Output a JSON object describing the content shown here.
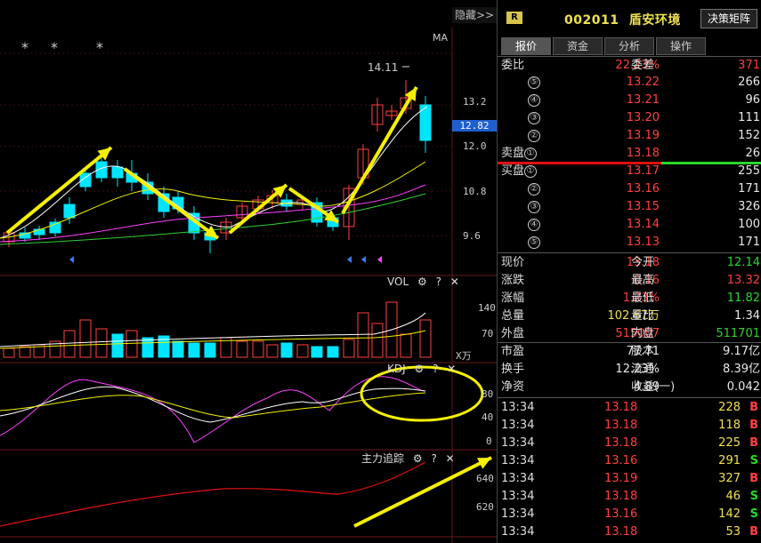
{
  "chart": {
    "hide_label": "隐藏>>",
    "ma_label": "MA",
    "high_mark": "14.11",
    "price_axis": [
      "13.2",
      "12.0",
      "10.8",
      "9.6"
    ],
    "current_price_tag": "12.82",
    "vol_title": "VOL",
    "vol_axis": [
      "140",
      "70"
    ],
    "vol_unit": "X万",
    "kdj_title": "KDJ",
    "kdj_axis": [
      "80",
      "40",
      "0"
    ],
    "main_track_title": "主力追踪",
    "main_track_axis": [
      "640",
      "620"
    ],
    "asterisk": "*",
    "gear_icon": "gear-icon",
    "help_label": "?",
    "close_label": "✕"
  },
  "panel": {
    "badge": "R",
    "stock_code": "002011",
    "stock_name": "盾安环境",
    "decision_button": "决策矩阵",
    "tabs": [
      "报价",
      "资金",
      "分析",
      "操作"
    ],
    "weibi_label": "委比",
    "weibi_value": "22.23%",
    "weicha_label": "委差",
    "weicha_value": "371",
    "sell_label": "卖盘",
    "buy_label": "买盘",
    "asks": [
      {
        "n": "⑤",
        "price": "13.22",
        "vol": "266"
      },
      {
        "n": "④",
        "price": "13.21",
        "vol": "96"
      },
      {
        "n": "③",
        "price": "13.20",
        "vol": "111"
      },
      {
        "n": "②",
        "price": "13.19",
        "vol": "152"
      },
      {
        "n": "①",
        "price": "13.18",
        "vol": "26"
      }
    ],
    "bids": [
      {
        "n": "①",
        "price": "13.17",
        "vol": "255"
      },
      {
        "n": "②",
        "price": "13.16",
        "vol": "171"
      },
      {
        "n": "③",
        "price": "13.15",
        "vol": "326"
      },
      {
        "n": "④",
        "price": "13.14",
        "vol": "100"
      },
      {
        "n": "⑤",
        "price": "13.13",
        "vol": "171"
      }
    ],
    "stats": [
      {
        "l1": "现价",
        "v1": "13.18",
        "c1": "red",
        "l2": "今开",
        "v2": "12.14",
        "c2": "green"
      },
      {
        "l1": "涨跌",
        "v1": "0.16",
        "c1": "red",
        "l2": "最高",
        "v2": "13.32",
        "c2": "red"
      },
      {
        "l1": "涨幅",
        "v1": "1.23%",
        "c1": "red",
        "l2": "最低",
        "v2": "11.82",
        "c2": "green"
      },
      {
        "l1": "总量",
        "v1": "102.67万",
        "c1": "yellow",
        "l2": "量比",
        "v2": "1.34",
        "c2": "white"
      },
      {
        "l1": "外盘",
        "v1": "515007",
        "c1": "red",
        "l2": "内盘",
        "v2": "511701",
        "c2": "green"
      }
    ],
    "stats2": [
      {
        "l1": "市盈",
        "v1": "77.71",
        "l2": "股本",
        "v2": "9.17亿"
      },
      {
        "l1": "换手",
        "v1": "12.23%",
        "l2": "流通",
        "v2": "8.39亿"
      },
      {
        "l1": "净资",
        "v1": "4.89",
        "l2": "收益(一)",
        "v2": "0.042"
      }
    ],
    "trades": [
      {
        "time": "13:34",
        "price": "13.18",
        "vol": "228",
        "dir": "B"
      },
      {
        "time": "13:34",
        "price": "13.18",
        "vol": "118",
        "dir": "B"
      },
      {
        "time": "13:34",
        "price": "13.18",
        "vol": "225",
        "dir": "B"
      },
      {
        "time": "13:34",
        "price": "13.16",
        "vol": "291",
        "dir": "S"
      },
      {
        "time": "13:34",
        "price": "13.19",
        "vol": "327",
        "dir": "B"
      },
      {
        "time": "13:34",
        "price": "13.18",
        "vol": "46",
        "dir": "S"
      },
      {
        "time": "13:34",
        "price": "13.16",
        "vol": "142",
        "dir": "S"
      },
      {
        "time": "13:34",
        "price": "13.18",
        "vol": "53",
        "dir": "B"
      }
    ]
  },
  "colors": {
    "up": "#ff4040",
    "down": "#00e5ff",
    "arrow": "#f5f000",
    "accent": "#1e5fd0"
  }
}
